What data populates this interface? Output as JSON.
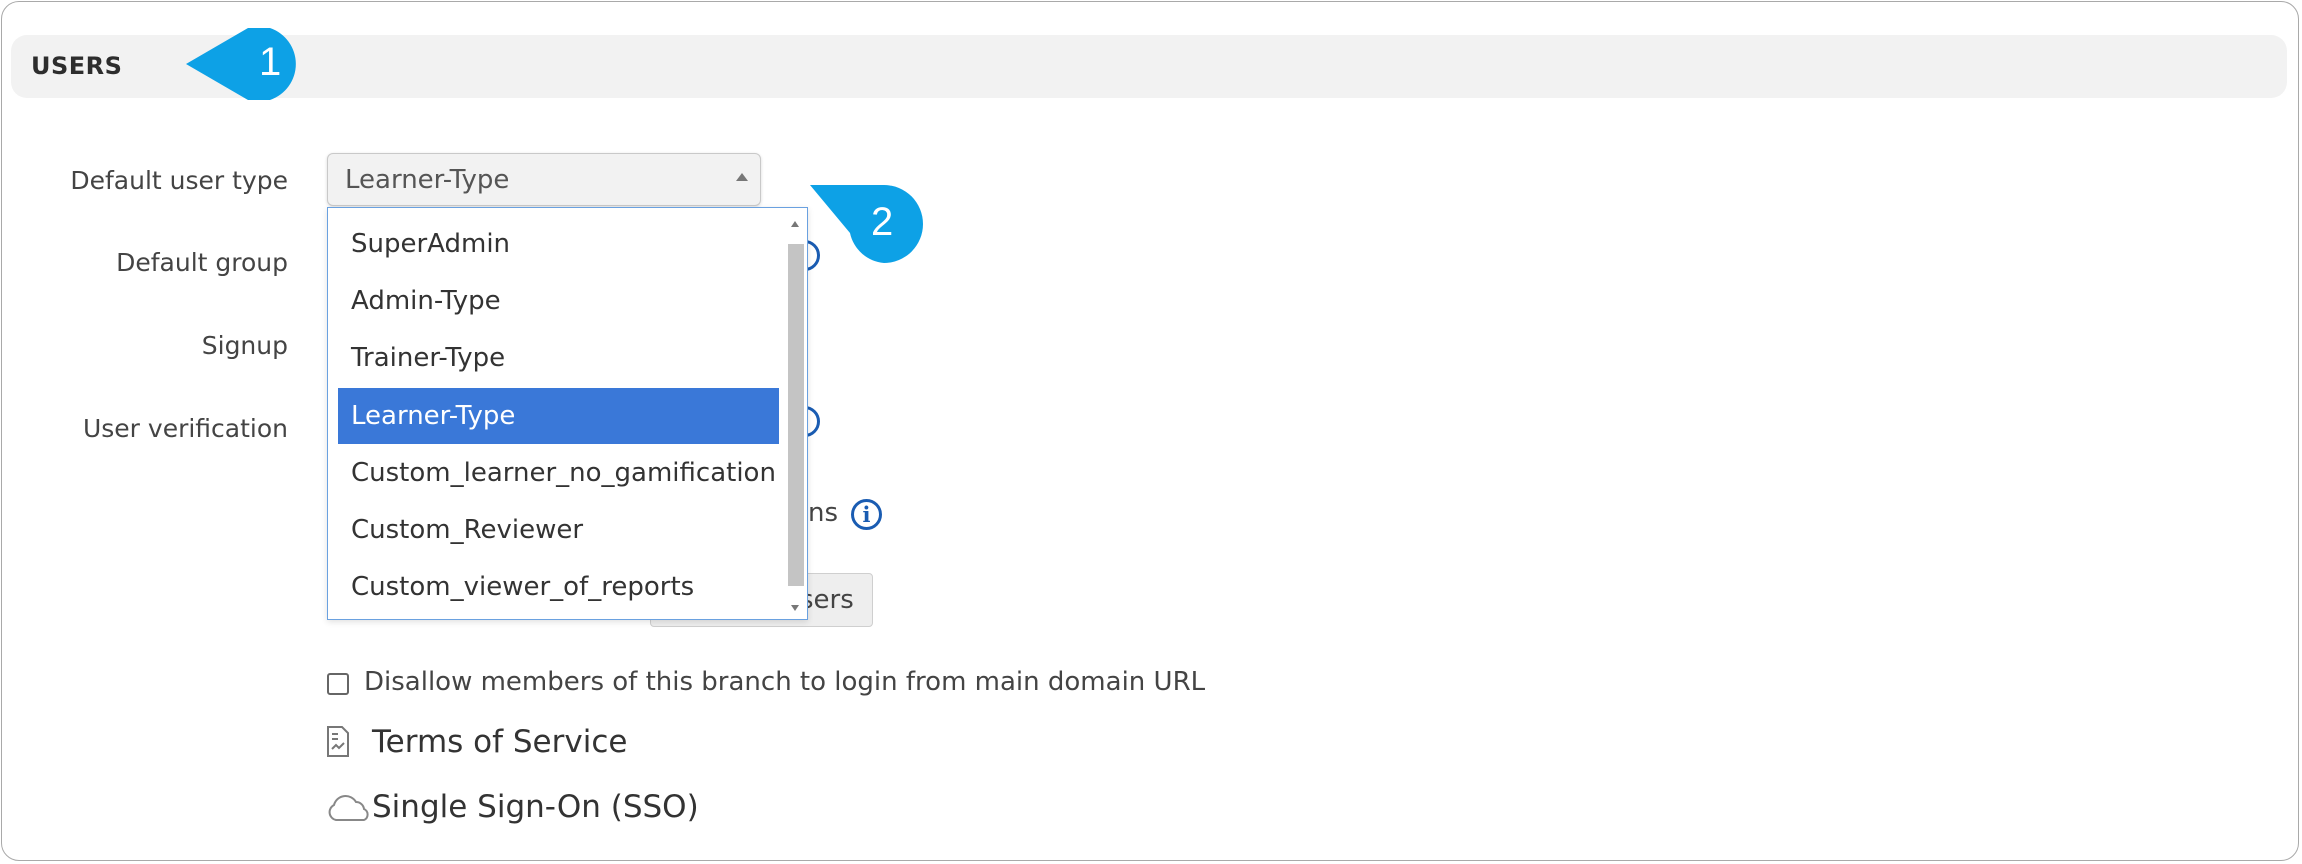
{
  "section": {
    "title": "USERS"
  },
  "callouts": {
    "one": "1",
    "two": "2"
  },
  "labels": {
    "default_user_type": "Default user type",
    "default_group": "Default group",
    "signup": "Signup",
    "user_verification": "User verification"
  },
  "user_type_select": {
    "value": "Learner-Type",
    "options": [
      "SuperAdmin",
      "Admin-Type",
      "Trainer-Type",
      "Learner-Type",
      "Custom_learner_no_gamification",
      "Custom_Reviewer",
      "Custom_viewer_of_reports"
    ],
    "selected_index": 3
  },
  "partial": {
    "ns_text": "ns",
    "users_button": "sers"
  },
  "checkbox": {
    "label": "Disallow members of this branch to login from main domain URL",
    "checked": false
  },
  "links": {
    "terms": "Terms of Service",
    "sso": "Single Sign-On (SSO)"
  },
  "colors": {
    "accent": "#3a78d8",
    "callout": "#0da1e6",
    "info": "#1a5cb2"
  },
  "icons": {
    "info": "info-icon",
    "terms": "document-icon",
    "sso": "cloud-icon"
  }
}
